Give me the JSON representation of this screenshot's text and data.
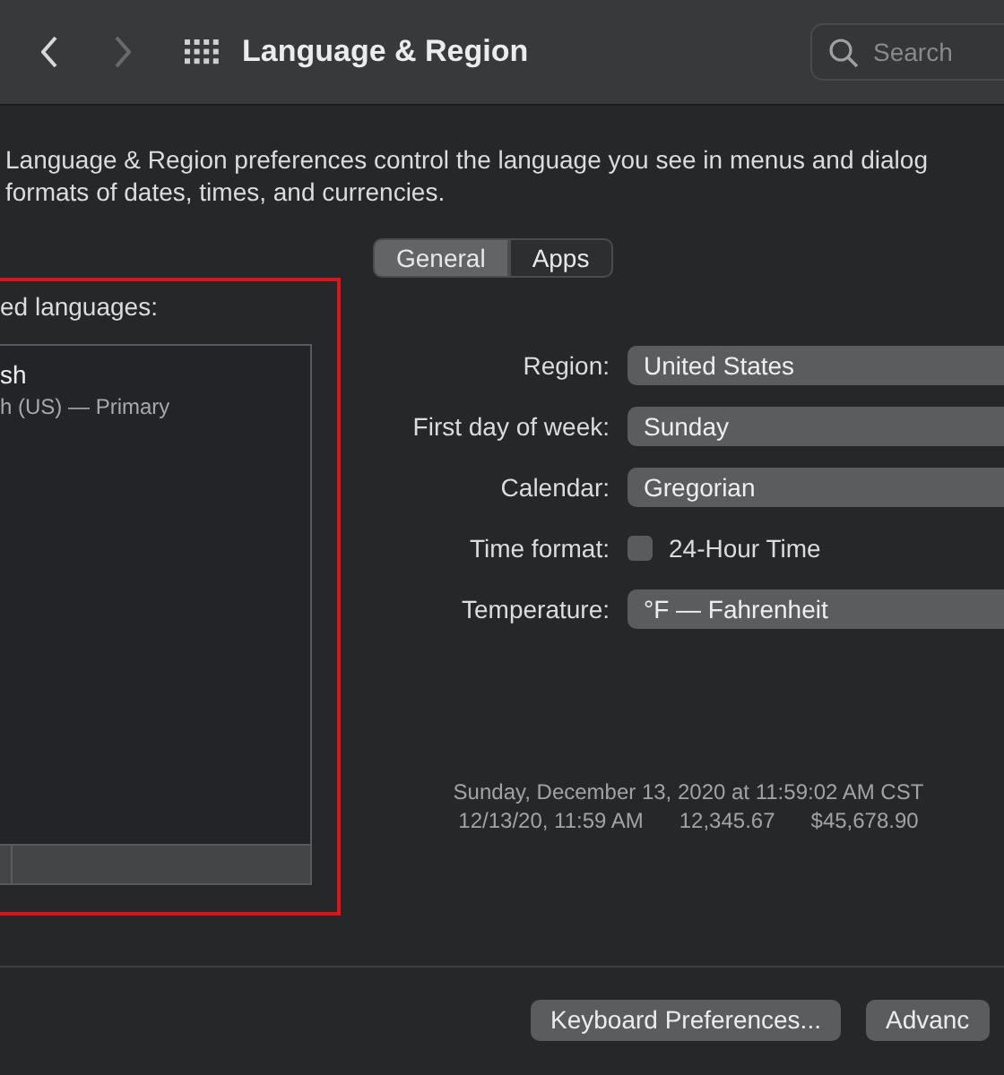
{
  "toolbar": {
    "title": "Language & Region",
    "back_enabled": true,
    "forward_enabled": false,
    "search": {
      "placeholder": "Search"
    }
  },
  "description": [
    "Language & Region preferences control the language you see in menus and dialog",
    "formats of dates, times, and currencies."
  ],
  "tabs": [
    {
      "label": "General",
      "selected": true
    },
    {
      "label": "Apps",
      "selected": false
    }
  ],
  "languages_panel": {
    "label": "ed languages:",
    "highlighted": true,
    "items": [
      {
        "name": "sh",
        "detail": "h (US) — Primary"
      }
    ]
  },
  "settings": [
    {
      "kind": "popup",
      "label": "Region:",
      "value": "United States"
    },
    {
      "kind": "popup",
      "label": "First day of week:",
      "value": "Sunday"
    },
    {
      "kind": "popup",
      "label": "Calendar:",
      "value": "Gregorian"
    },
    {
      "kind": "checkbox",
      "label": "Time format:",
      "value": "24-Hour Time",
      "checked": false
    },
    {
      "kind": "popup",
      "label": "Temperature:",
      "value": "°F — Fahrenheit"
    }
  ],
  "sample": {
    "line_1": "Sunday, December 13, 2020 at 11:59:02 AM CST",
    "line_2": [
      "12/13/20, 11:59 AM",
      "12,345.67",
      "$45,678.90"
    ]
  },
  "buttons": [
    "Keyboard Preferences...",
    "Advanc"
  ]
}
